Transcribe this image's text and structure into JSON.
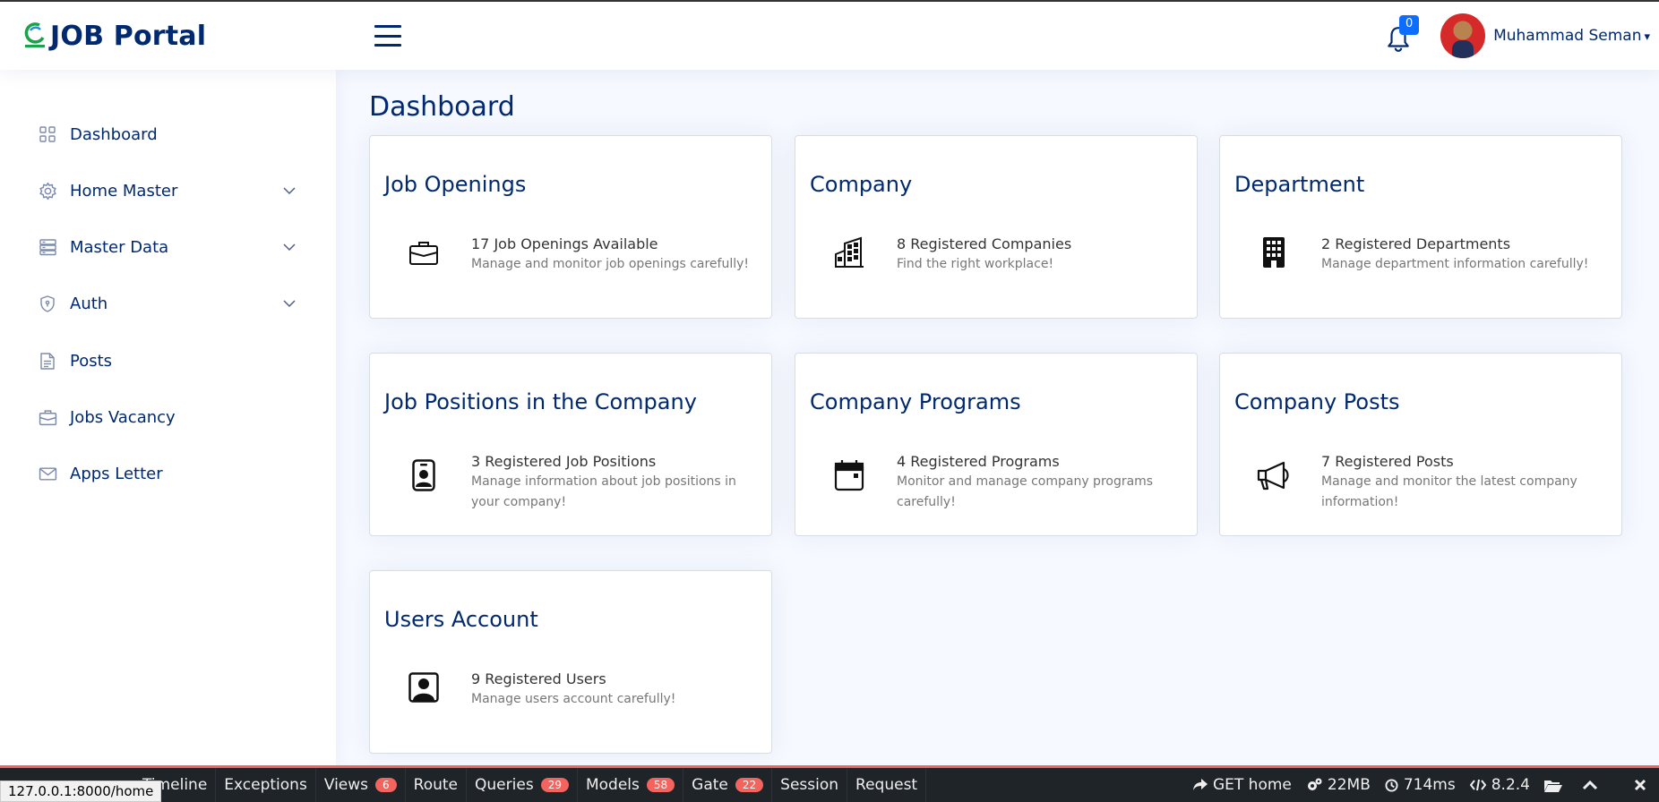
{
  "header": {
    "logo_text": "JOB Portal",
    "notification_count": "0",
    "user_name": "Muhammad Seman"
  },
  "sidebar": {
    "items": [
      {
        "label": "Dashboard",
        "icon": "grid-icon"
      },
      {
        "label": "Home Master",
        "icon": "gear-icon",
        "expandable": true
      },
      {
        "label": "Master Data",
        "icon": "server-icon",
        "expandable": true
      },
      {
        "label": "Auth",
        "icon": "shield-icon",
        "expandable": true
      },
      {
        "label": "Posts",
        "icon": "file-text-icon"
      },
      {
        "label": "Jobs Vacancy",
        "icon": "briefcase-icon"
      },
      {
        "label": "Apps Letter",
        "icon": "envelope-icon"
      }
    ]
  },
  "main": {
    "title": "Dashboard",
    "cards": [
      {
        "title": "Job Openings",
        "main": "17 Job Openings Available",
        "sub": "Manage and monitor job openings carefully!",
        "icon": "briefcase-icon"
      },
      {
        "title": "Company",
        "main": "8 Registered Companies",
        "sub": "Find the right workplace!",
        "icon": "buildings-icon"
      },
      {
        "title": "Department",
        "main": "2 Registered Departments",
        "sub": "Manage department information carefully!",
        "icon": "building-icon"
      },
      {
        "title": "Job Positions in the Company",
        "main": "3 Registered Job Positions",
        "sub": "Manage information about job positions in your company!",
        "icon": "person-badge-icon"
      },
      {
        "title": "Company Programs",
        "main": "4 Registered Programs",
        "sub": "Monitor and manage company programs carefully!",
        "icon": "calendar-icon"
      },
      {
        "title": "Company Posts",
        "main": "7 Registered Posts",
        "sub": "Manage and monitor the latest company information!",
        "icon": "megaphone-icon"
      },
      {
        "title": "Users Account",
        "main": "9 Registered Users",
        "sub": "Manage users account carefully!",
        "icon": "person-square-icon"
      }
    ]
  },
  "debugbar": {
    "tabs": [
      {
        "label": "Timeline"
      },
      {
        "label": "Exceptions"
      },
      {
        "label": "Views",
        "badge": "6"
      },
      {
        "label": "Route"
      },
      {
        "label": "Queries",
        "badge": "29"
      },
      {
        "label": "Models",
        "badge": "58"
      },
      {
        "label": "Gate",
        "badge": "22"
      },
      {
        "label": "Session"
      },
      {
        "label": "Request"
      }
    ],
    "route": "GET home",
    "memory": "22MB",
    "time": "714ms",
    "php_version": "8.2.4",
    "accent_color": "#f4645f"
  },
  "status_url": "127.0.0.1:8000/home"
}
